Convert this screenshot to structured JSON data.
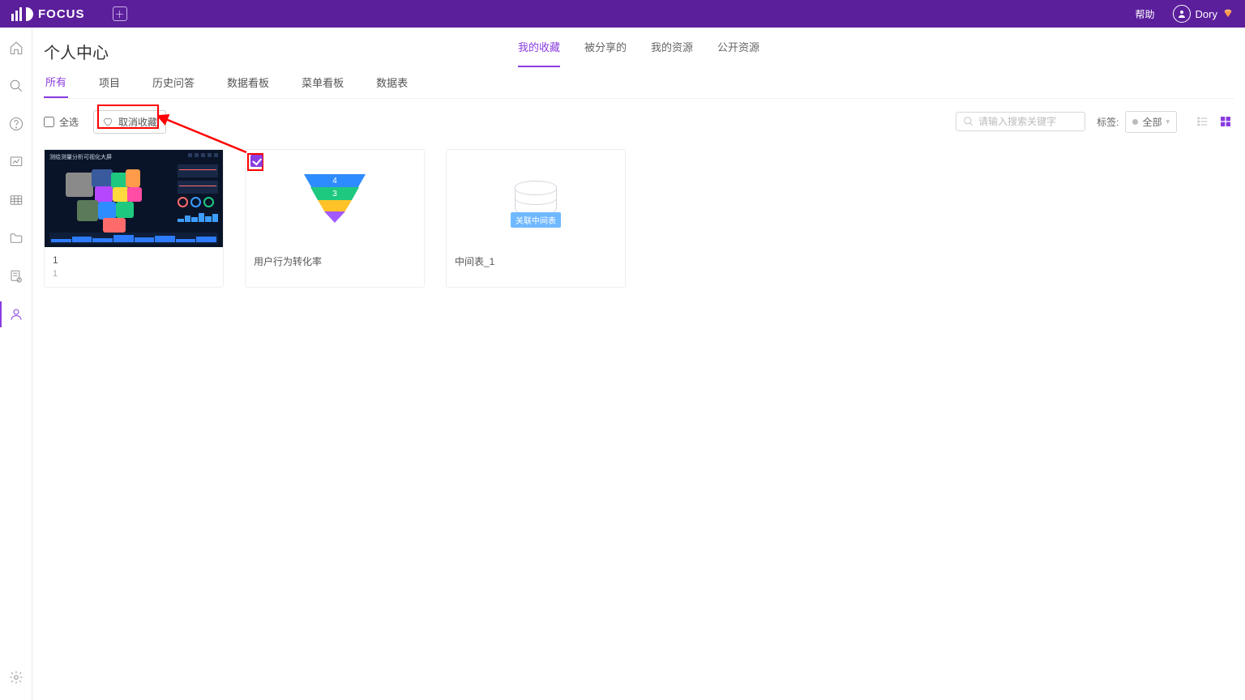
{
  "header": {
    "brand": "FOCUS",
    "help": "帮助",
    "user": "Dory"
  },
  "page": {
    "title": "个人中心"
  },
  "topTabs": {
    "items": [
      "我的收藏",
      "被分享的",
      "我的资源",
      "公开资源"
    ],
    "activeIndex": 0
  },
  "subTabs": {
    "items": [
      "所有",
      "项目",
      "历史问答",
      "数据看板",
      "菜单看板",
      "数据表"
    ],
    "activeIndex": 0
  },
  "toolbar": {
    "selectAll": "全选",
    "unfavorite": "取消收藏",
    "searchPlaceholder": "请输入搜索关键字",
    "tagLabel": "标签:",
    "tagAll": "全部"
  },
  "cards": [
    {
      "title": "1",
      "subtitle": "1",
      "checked": false,
      "thumb": "map",
      "mapTitle": "测绘测量分析可视化大屏"
    },
    {
      "title": "用户行为转化率",
      "checked": true,
      "thumb": "funnel",
      "funnel": [
        "4",
        "3",
        "",
        ""
      ]
    },
    {
      "title": "中间表_1",
      "checked": false,
      "thumb": "db",
      "badge": "关联中间表"
    }
  ]
}
